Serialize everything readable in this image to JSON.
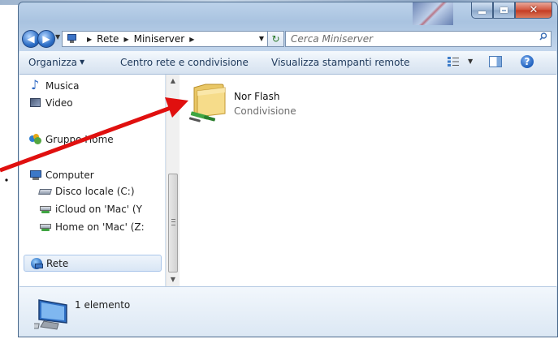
{
  "window": {
    "caption_buttons": {
      "minimize_icon": "minimize-icon",
      "maximize_icon": "maximize-icon",
      "close_icon": "close-icon"
    }
  },
  "nav": {
    "back_icon": "back-arrow-icon",
    "forward_icon": "forward-arrow-icon",
    "breadcrumb": [
      "Rete",
      "Miniserver"
    ],
    "search_placeholder": "Cerca Miniserver"
  },
  "toolbar": {
    "organize_label": "Organizza",
    "network_center_label": "Centro rete e condivisione",
    "view_printers_label": "Visualizza stampanti remote"
  },
  "sidebar": {
    "items": [
      {
        "label": "Musica",
        "icon": "music-icon"
      },
      {
        "label": "Video",
        "icon": "video-icon"
      },
      {
        "label": "Gruppo Home",
        "icon": "homegroup-icon"
      },
      {
        "label": "Computer",
        "icon": "computer-icon"
      },
      {
        "label": "Disco locale (C:)",
        "icon": "drive-icon"
      },
      {
        "label": "iCloud on 'Mac' (Y",
        "icon": "network-drive-icon"
      },
      {
        "label": "Home on 'Mac' (Z:",
        "icon": "network-drive-icon"
      },
      {
        "label": "Rete",
        "icon": "network-icon"
      }
    ],
    "selected": "Rete"
  },
  "content": {
    "items": [
      {
        "name": "Nor Flash",
        "type": "Condivisione",
        "icon": "shared-folder-icon"
      }
    ]
  },
  "status": {
    "item_count": "1 elemento"
  },
  "colors": {
    "annotation_arrow": "#e0100f",
    "accent": "#1e395b"
  }
}
